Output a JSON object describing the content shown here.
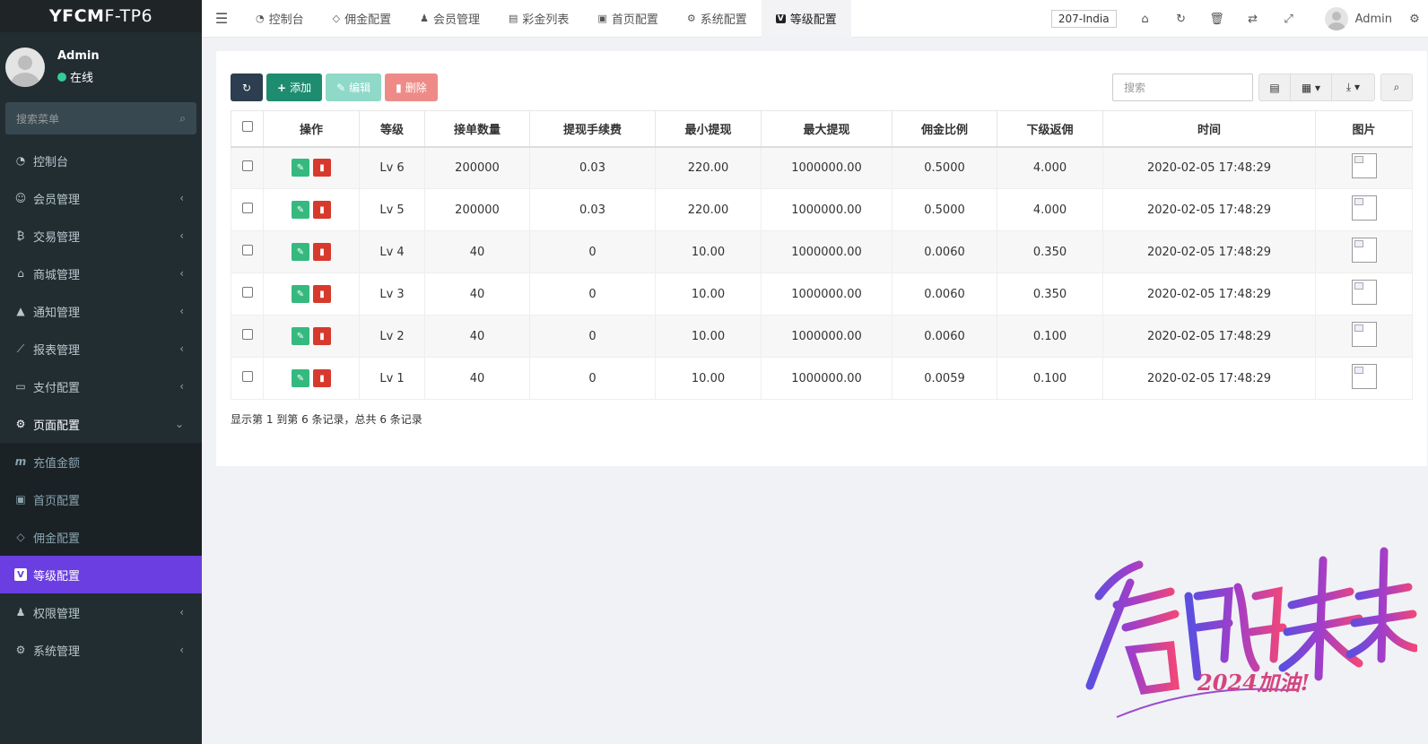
{
  "brand": {
    "bold": "YFCM",
    "rest": "F-TP6"
  },
  "user": {
    "name": "Admin",
    "status": "在线"
  },
  "sidebar_search_placeholder": "搜索菜单",
  "menu": [
    {
      "label": "控制台",
      "icon": "dashboard-icon",
      "glyph": "◔"
    },
    {
      "label": "会员管理",
      "icon": "user-circle-icon",
      "glyph": "☺"
    },
    {
      "label": "交易管理",
      "icon": "bitcoin-icon",
      "glyph": "₿"
    },
    {
      "label": "商城管理",
      "icon": "home-icon",
      "glyph": "⌂"
    },
    {
      "label": "通知管理",
      "icon": "bell-icon",
      "glyph": "🔔"
    },
    {
      "label": "报表管理",
      "icon": "line-chart-icon",
      "glyph": "📈"
    },
    {
      "label": "支付配置",
      "icon": "credit-card-icon",
      "glyph": "▭"
    },
    {
      "label": "页面配置",
      "icon": "gear-icon",
      "glyph": "⚙"
    }
  ],
  "submenu": [
    {
      "label": "充值金额",
      "icon": "m-icon",
      "glyph": "m"
    },
    {
      "label": "首页配置",
      "icon": "square-icon",
      "glyph": "▣"
    },
    {
      "label": "佣金配置",
      "icon": "diamond-icon",
      "glyph": "◇"
    },
    {
      "label": "等级配置",
      "icon": "vimeo-icon",
      "glyph": "V"
    }
  ],
  "menu_after": [
    {
      "label": "权限管理",
      "icon": "group-icon",
      "glyph": "👥"
    },
    {
      "label": "系统管理",
      "icon": "cogs-icon",
      "glyph": "⚙"
    }
  ],
  "tabs": [
    {
      "label": "控制台",
      "icon": "dashboard-icon",
      "glyph": "◔"
    },
    {
      "label": "佣金配置",
      "icon": "diamond-icon",
      "glyph": "◇"
    },
    {
      "label": "会员管理",
      "icon": "user-icon",
      "glyph": "♟"
    },
    {
      "label": "彩金列表",
      "icon": "gift-icon",
      "glyph": "🎁"
    },
    {
      "label": "首页配置",
      "icon": "square-icon",
      "glyph": "▣"
    },
    {
      "label": "系统配置",
      "icon": "gear-icon",
      "glyph": "⚙"
    },
    {
      "label": "等级配置",
      "icon": "vimeo-icon",
      "glyph": "V"
    }
  ],
  "lang": "207-India",
  "top_user": "Admin",
  "toolbar": {
    "add": "添加",
    "edit": "编辑",
    "delete": "删除",
    "search_placeholder": "搜索"
  },
  "table": {
    "headers": [
      "操作",
      "等级",
      "接单数量",
      "提现手续费",
      "最小提现",
      "最大提现",
      "佣金比例",
      "下级返佣",
      "时间",
      "图片"
    ],
    "rows": [
      [
        "Lv 6",
        "200000",
        "0.03",
        "220.00",
        "1000000.00",
        "0.5000",
        "4.000",
        "2020-02-05 17:48:29"
      ],
      [
        "Lv 5",
        "200000",
        "0.03",
        "220.00",
        "1000000.00",
        "0.5000",
        "4.000",
        "2020-02-05 17:48:29"
      ],
      [
        "Lv 4",
        "40",
        "0",
        "10.00",
        "1000000.00",
        "0.0060",
        "0.350",
        "2020-02-05 17:48:29"
      ],
      [
        "Lv 3",
        "40",
        "0",
        "10.00",
        "1000000.00",
        "0.0060",
        "0.350",
        "2020-02-05 17:48:29"
      ],
      [
        "Lv 2",
        "40",
        "0",
        "10.00",
        "1000000.00",
        "0.0060",
        "0.100",
        "2020-02-05 17:48:29"
      ],
      [
        "Lv 1",
        "40",
        "0",
        "10.00",
        "1000000.00",
        "0.0059",
        "0.100",
        "2020-02-05 17:48:29"
      ]
    ]
  },
  "footer": "显示第 1 到第 6 条记录，总共 6 条记录",
  "watermark": {
    "main": "启航未来",
    "sub": "2024加油!"
  },
  "colors": {
    "active_menu": "#6a3ee0",
    "sidebar_bg": "#222d32",
    "add_btn": "#1e8c6e",
    "edit_btn": "#8fd9c8",
    "delete_btn": "#ee8b86"
  }
}
